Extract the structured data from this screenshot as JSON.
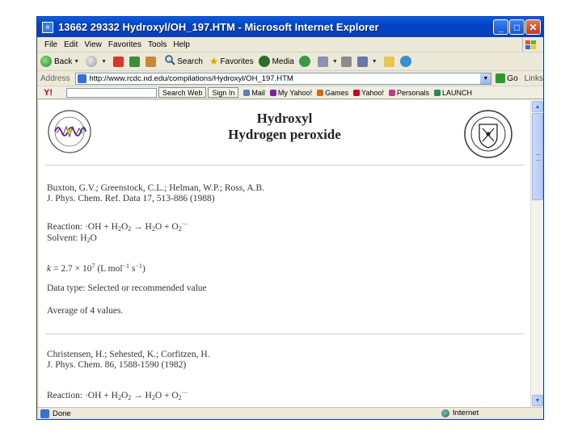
{
  "window": {
    "title": "13662 29332 Hydroxyl/OH_197.HTM - Microsoft Internet Explorer",
    "min_glyph": "_",
    "max_glyph": "□",
    "close_glyph": "✕"
  },
  "menu": [
    "File",
    "Edit",
    "View",
    "Favorites",
    "Tools",
    "Help"
  ],
  "toolbar": {
    "back": "Back",
    "search": "Search",
    "favorites": "Favorites",
    "media": "Media"
  },
  "address": {
    "label": "Address",
    "url": "http://www.rcdc.nd.edu/compilations/Hydroxyl/OH_197.HTM",
    "go": "Go",
    "links": "Links"
  },
  "yahoo": {
    "logo": "Y!",
    "search_web": "Search Web",
    "sign_in": "Sign In",
    "mail": "Mail",
    "my_yahoo": "My Yahoo!",
    "games": "Games",
    "yahoo": "Yahoo!",
    "personals": "Personals",
    "launch": "LAUNCH"
  },
  "page": {
    "title_line1": "Hydroxyl",
    "title_line2": "Hydrogen peroxide",
    "entry1": {
      "authors": "Buxton, G.V.; Greenstock, C.L.; Helman, W.P.; Ross, A.B.",
      "journal": "J. Phys. Chem. Ref. Data 17, 513-886 (1988)",
      "reaction_prefix": "Reaction: ·OH + H",
      "reaction_mid1": "O",
      "reaction_arrow": " → H",
      "reaction_mid2": "O + O",
      "reaction_end": "·−",
      "solvent_prefix": "Solvent: H",
      "solvent_end": "O",
      "rate_k": "k",
      "rate_value": " = 2.7 × 10",
      "rate_exp": "7",
      "rate_units": " (L mol",
      "rate_units2": " s",
      "rate_close": ")",
      "neg1": "−1",
      "data_type": "Data type: Selected or recommended value",
      "average": "Average of 4 values."
    },
    "entry2": {
      "authors": "Christensen, H.; Sehested, K.; Corfitzen, H.",
      "journal": "J. Phys. Chem. 86, 1588-1590 (1982)",
      "reaction_prefix": "Reaction: ·OH + H",
      "reaction_mid1": "O",
      "reaction_arrow": " → H",
      "reaction_mid2": "O + O",
      "reaction_end": "·−"
    },
    "sub2": "2"
  },
  "status": {
    "text": "Done",
    "zone": "Internet"
  }
}
